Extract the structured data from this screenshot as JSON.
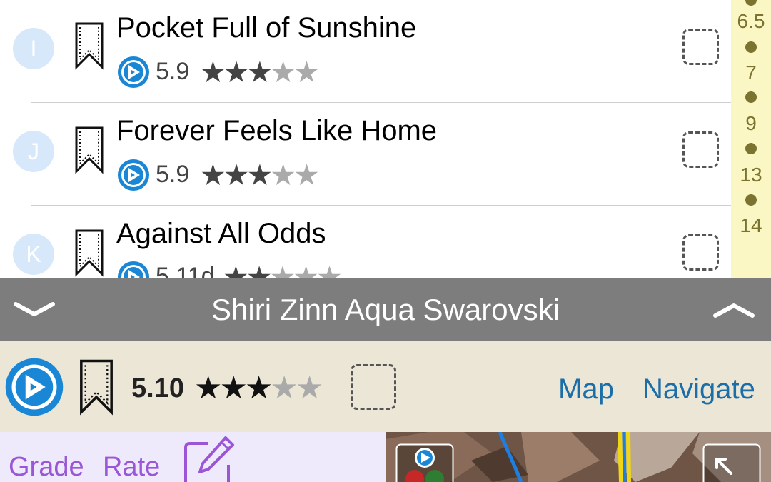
{
  "routes": [
    {
      "letter": "I",
      "name": "Pocket Full of Sunshine",
      "grade": "5.9",
      "stars": 3,
      "max_stars": 5
    },
    {
      "letter": "J",
      "name": "Forever Feels Like Home",
      "grade": "5.9",
      "stars": 3,
      "max_stars": 5
    },
    {
      "letter": "K",
      "name": "Against All Odds",
      "grade": "5.11d",
      "stars": 2,
      "max_stars": 5
    }
  ],
  "index_bar": {
    "labels": [
      "6.5",
      "7",
      "9",
      "13",
      "14"
    ]
  },
  "detail": {
    "title": "Shiri Zinn Aqua Swarovski",
    "grade": "5.10",
    "stars": 3,
    "max_stars": 5,
    "map_label": "Map",
    "navigate_label": "Navigate",
    "grade_action": "Grade",
    "rate_action": "Rate"
  },
  "colors": {
    "accent": "#1b6ea8",
    "action": "#9a56d6",
    "header_bg": "#7d7d7d",
    "info_bg": "#ebe6d6",
    "index_bg": "#fbf7c5"
  },
  "icons": [
    "bookmark-icon",
    "climbing-app-logo-icon",
    "checkbox-icon",
    "chevron-down-icon",
    "chevron-up-icon",
    "edit-pencil-icon",
    "expand-icon"
  ]
}
